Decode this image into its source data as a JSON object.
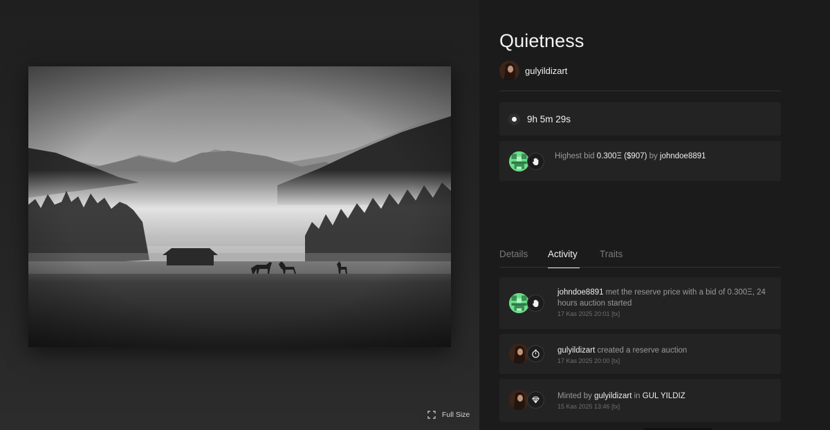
{
  "artwork": {
    "full_size_label": "Full Size",
    "icon": "expand-icon"
  },
  "token": {
    "title": "Quietness",
    "creator": "gulyildizart"
  },
  "auction": {
    "countdown": "9h 5m 29s",
    "highest_bid_prefix": "Highest bid",
    "highest_bid_amount": "0.300Ξ ($907)",
    "by_word": "by",
    "bidder": "johndoe8891"
  },
  "tabs": [
    {
      "label": "Details"
    },
    {
      "label": "Activity",
      "active": true
    },
    {
      "label": "Traits"
    }
  ],
  "activity": [
    {
      "actor": "johndoe8891",
      "text": "met the reserve price with a bid of 0.300Ξ, 24 hours auction started",
      "time": "17 Kas 2025 20:01",
      "tx": "[tx]",
      "icon": "hand-icon"
    },
    {
      "actor": "gulyildizart",
      "text": "created a reserve auction",
      "time": "17 Kas 2025 20:00",
      "tx": "[tx]",
      "icon": "stopwatch-icon"
    },
    {
      "prefix": "Minted by",
      "actor": "gulyildizart",
      "middle": "in",
      "collection": "GUL YILDIZ",
      "time": "15 Kas 2025 13:46",
      "tx": "[tx]",
      "icon": "diamond-icon"
    }
  ],
  "colors": {
    "background": "#1b1b1b",
    "card": "#232323",
    "text_primary": "#f0f0f0",
    "text_muted": "#9a9a9a",
    "bidder_avatar": "#6edc8a"
  }
}
